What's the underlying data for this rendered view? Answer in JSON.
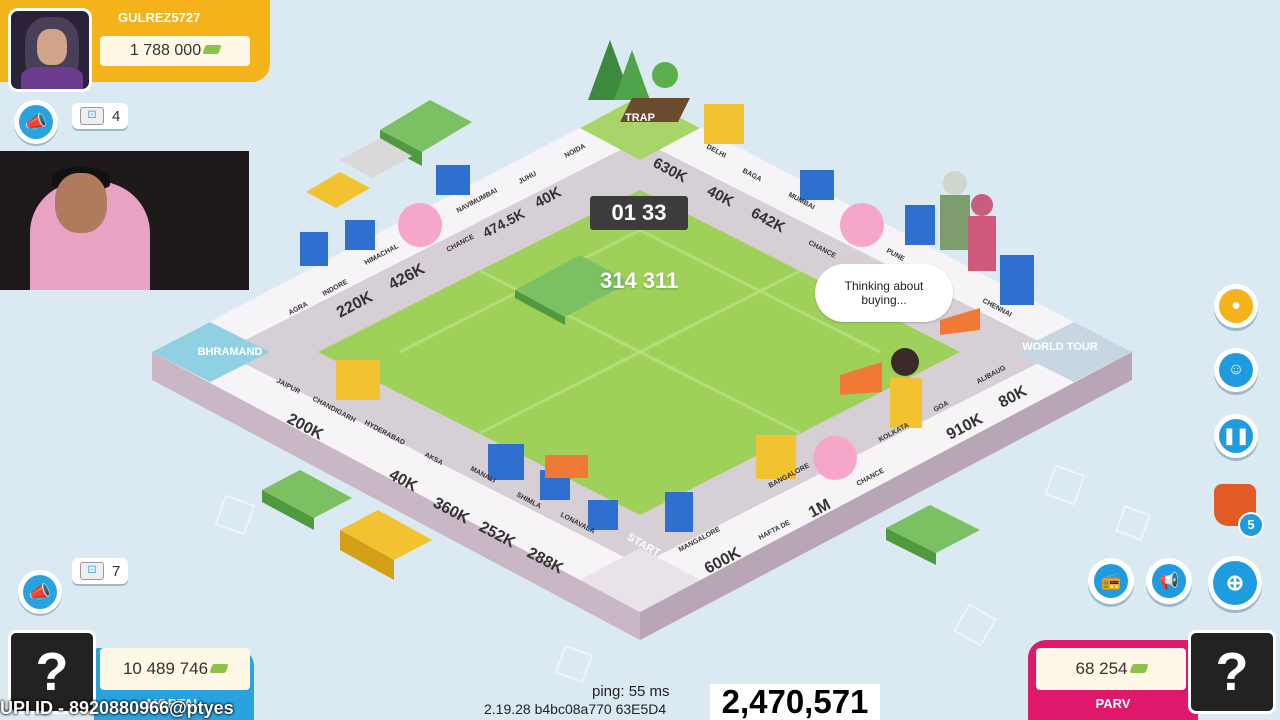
{
  "players": {
    "top": {
      "name": "GULREZ5727",
      "money": "1 788 000",
      "dice_count": "4"
    },
    "bottom_left": {
      "name": "MORTAL",
      "money": "10 489 746",
      "dice_count": "7",
      "avatar": "?"
    },
    "bottom_right": {
      "name": "PARV",
      "money": "68 254",
      "avatar": "?"
    }
  },
  "board": {
    "timer": "01 33",
    "pot": "314 311",
    "speech": "Thinking about buying...",
    "corners": {
      "top": "TRAP",
      "left": "BHRAMAND",
      "right": "WORLD TOUR",
      "bottom": "START"
    },
    "tiles_top_left": [
      {
        "name": "AGRA",
        "price": "220K"
      },
      {
        "name": "INDORE",
        "price": ""
      },
      {
        "name": "HIMACHAL",
        "price": "426K"
      },
      {
        "name": "CHANCE",
        "price": ""
      },
      {
        "name": "NAVIMUMBAI",
        "price": "474.5K"
      },
      {
        "name": "JUHU",
        "price": "40K"
      },
      {
        "name": "NOIDA",
        "price": ""
      }
    ],
    "tiles_top_right": [
      {
        "name": "DELHI",
        "price": "630K"
      },
      {
        "name": "BAGA",
        "price": "40K"
      },
      {
        "name": "MUMBAI",
        "price": "642K"
      },
      {
        "name": "CHANCE",
        "price": ""
      },
      {
        "name": "PUNE",
        "price": ""
      },
      {
        "name": "CHENNAI",
        "price": ""
      }
    ],
    "tiles_bottom_right": [
      {
        "name": "ALIBAUG",
        "price": "80K"
      },
      {
        "name": "GOA",
        "price": "910K"
      },
      {
        "name": "KOLKATA",
        "price": ""
      },
      {
        "name": "CHANCE",
        "price": ""
      },
      {
        "name": "BANGALORE",
        "price": "1M"
      },
      {
        "name": "HAFTA DE",
        "price": ""
      },
      {
        "name": "MANGALORE",
        "price": "600K"
      }
    ],
    "tiles_bottom_left": [
      {
        "name": "JAIPUR",
        "price": "200K"
      },
      {
        "name": "CHANDIGARH",
        "price": ""
      },
      {
        "name": "HYDERABAD",
        "price": ""
      },
      {
        "name": "AKSA",
        "price": "40K"
      },
      {
        "name": "MANALI",
        "price": "360K"
      },
      {
        "name": "SHIMLA",
        "price": "252K"
      },
      {
        "name": "LONAVALA",
        "price": "288K"
      }
    ]
  },
  "hud": {
    "ping": "ping: 55 ms",
    "version": "2.19.28 b4bc08a770 63E5D4",
    "counter": "2,470,571",
    "upi": "UPI ID - 8920880966@ptyes",
    "notification_badge": "5"
  },
  "colors": {
    "gold": "#f4b31a",
    "blue": "#29a3e0",
    "pink": "#e0186b",
    "grass": "#9fd15a"
  }
}
